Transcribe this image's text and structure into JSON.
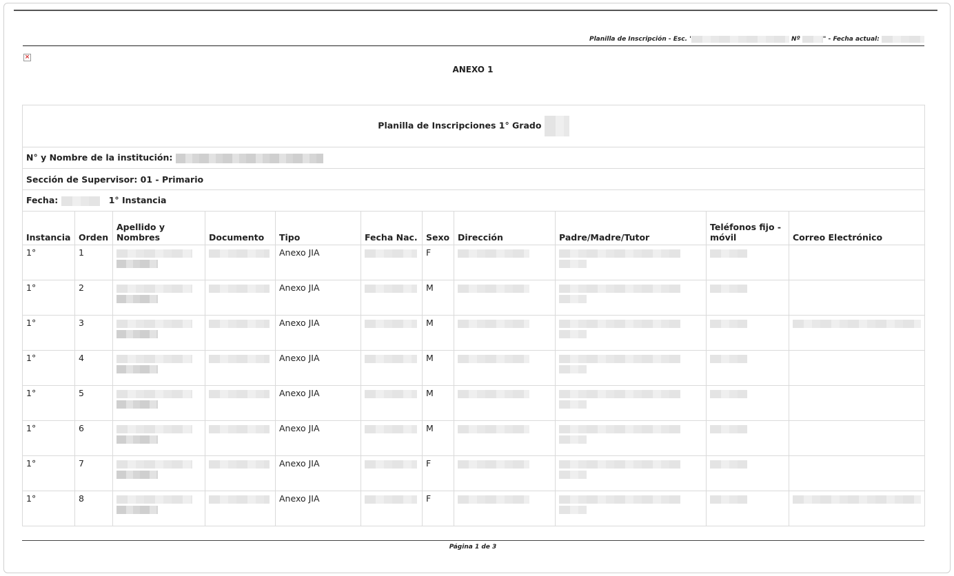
{
  "header": {
    "school_label": "Planilla de Inscripción - Esc. '",
    "number_label": "Nº",
    "date_label": "\" - Fecha actual:"
  },
  "annex_title": "ANEXO 1",
  "sheet": {
    "title": "Planilla de Inscripciones 1° Grado",
    "institution_label": "N° y Nombre de la institución:",
    "supervisor_label": "Sección de Supervisor: 01 - Primario",
    "date_label": "Fecha:",
    "instance_label": "1° Instancia",
    "columns": [
      "Instancia",
      "Orden",
      "Apellido y Nombres",
      "Documento",
      "Tipo",
      "Fecha Nac.",
      "Sexo",
      "Dirección",
      "Padre/Madre/Tutor",
      "Teléfonos fijo - móvil",
      "Correo Electrónico"
    ],
    "rows": [
      {
        "instancia": "1°",
        "orden": "1",
        "tipo": "Anexo JIA",
        "sexo": "F"
      },
      {
        "instancia": "1°",
        "orden": "2",
        "tipo": "Anexo JIA",
        "sexo": "M"
      },
      {
        "instancia": "1°",
        "orden": "3",
        "tipo": "Anexo JIA",
        "sexo": "M"
      },
      {
        "instancia": "1°",
        "orden": "4",
        "tipo": "Anexo JIA",
        "sexo": "M"
      },
      {
        "instancia": "1°",
        "orden": "5",
        "tipo": "Anexo JIA",
        "sexo": "M"
      },
      {
        "instancia": "1°",
        "orden": "6",
        "tipo": "Anexo JIA",
        "sexo": "M"
      },
      {
        "instancia": "1°",
        "orden": "7",
        "tipo": "Anexo JIA",
        "sexo": "F"
      },
      {
        "instancia": "1°",
        "orden": "8",
        "tipo": "Anexo JIA",
        "sexo": "F"
      }
    ]
  },
  "footer": {
    "page_label": "Página 1 de 3"
  },
  "icons": {
    "broken_image": "broken-image-icon"
  }
}
